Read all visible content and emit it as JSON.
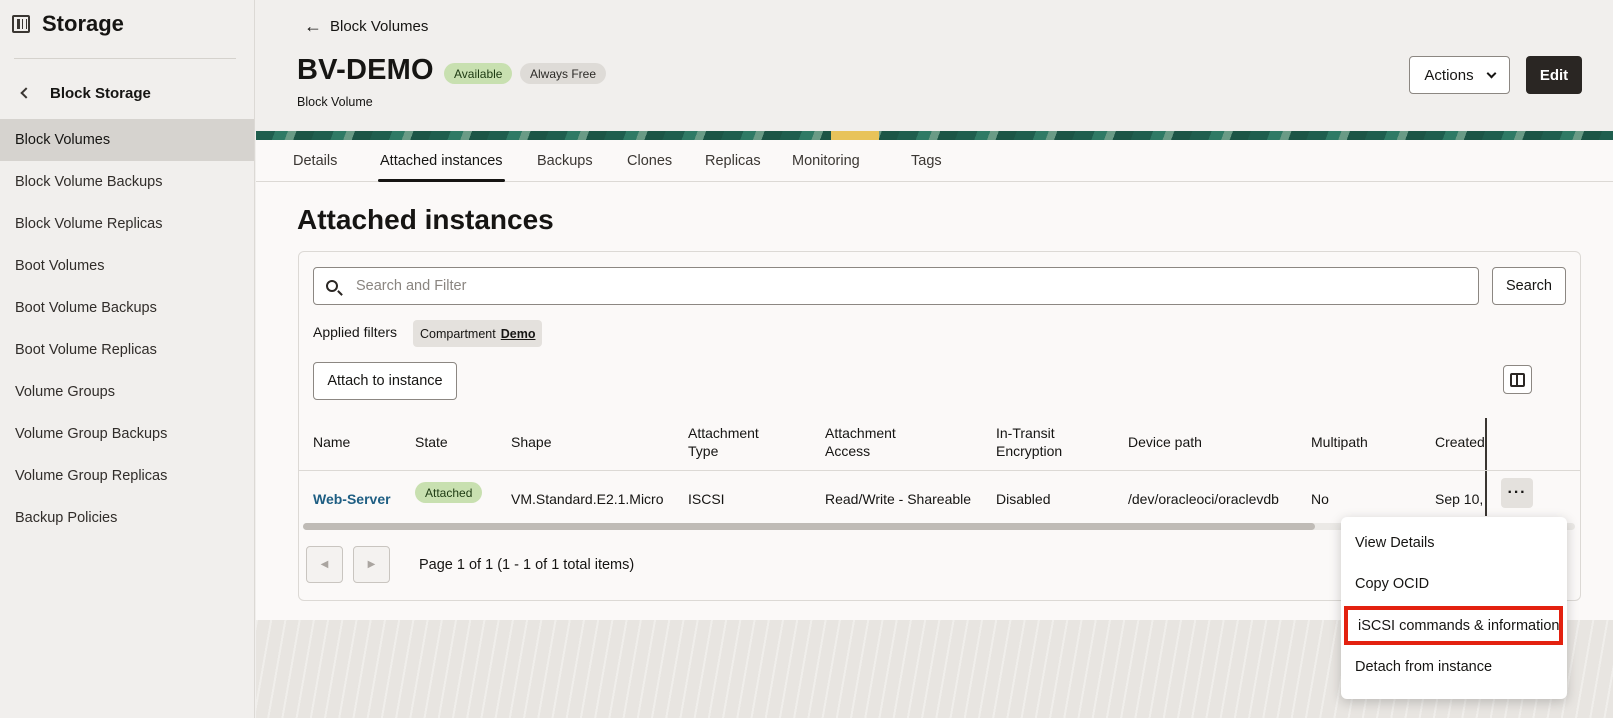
{
  "sidebar": {
    "title": "Storage",
    "back_label": "Block Storage",
    "items": [
      {
        "label": "Block Volumes",
        "active": true
      },
      {
        "label": "Block Volume Backups"
      },
      {
        "label": "Block Volume Replicas"
      },
      {
        "label": "Boot Volumes"
      },
      {
        "label": "Boot Volume Backups"
      },
      {
        "label": "Boot Volume Replicas"
      },
      {
        "label": "Volume Groups"
      },
      {
        "label": "Volume Group Backups"
      },
      {
        "label": "Volume Group Replicas"
      },
      {
        "label": "Backup Policies"
      }
    ]
  },
  "header": {
    "back_label": "Block Volumes",
    "title": "BV-DEMO",
    "badges": [
      "Available",
      "Always Free"
    ],
    "subtitle": "Block Volume",
    "actions_label": "Actions",
    "edit_label": "Edit"
  },
  "tabs": [
    "Details",
    "Attached instances",
    "Backups",
    "Clones",
    "Replicas",
    "Monitoring",
    "Tags"
  ],
  "active_tab": "Attached instances",
  "section": {
    "title": "Attached instances",
    "search_placeholder": "Search and Filter",
    "search_button": "Search",
    "applied_filters_label": "Applied filters",
    "filter_chip": {
      "label": "Compartment",
      "value": "Demo"
    },
    "attach_button": "Attach to instance"
  },
  "table": {
    "columns": [
      "Name",
      "State",
      "Shape",
      "Attachment Type",
      "Attachment Access",
      "In-Transit Encryption",
      "Device path",
      "Multipath",
      "Created"
    ],
    "rows": [
      {
        "name": "Web-Server",
        "state": "Attached",
        "shape": "VM.Standard.E2.1.Micro",
        "attachment_type": "ISCSI",
        "attachment_access": "Read/Write - Shareable",
        "encryption": "Disabled",
        "device_path": "/dev/oracleoci/oraclevdb",
        "multipath": "No",
        "created": "Sep 10, 2"
      }
    ],
    "row_menu_label": "···",
    "pagination_text": "Page 1 of 1 (1 - 1 of 1 total items)"
  },
  "row_menu": {
    "items": [
      "View Details",
      "Copy OCID",
      "iSCSI commands & information",
      "Detach from instance"
    ],
    "highlighted": "iSCSI commands & information"
  },
  "colors": {
    "badge_green": "#c8e0b0",
    "link": "#1e5e83",
    "highlight": "#e3210f",
    "edit_button": "#2a2623"
  }
}
